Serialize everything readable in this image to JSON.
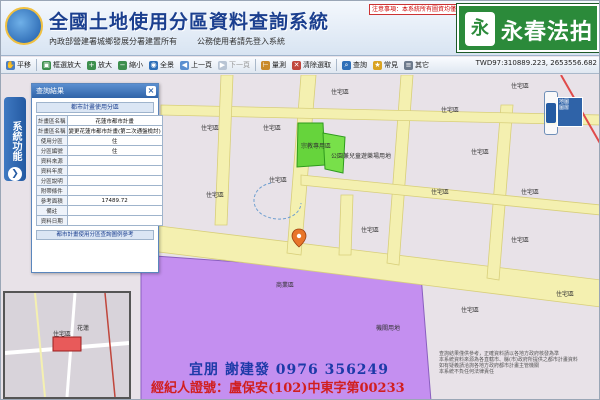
{
  "header": {
    "title": "全國土地使用分區資料查詢系統",
    "sub_left": "內政部營建署城鄉發展分署建置所有",
    "sub_right": "公務使用者請先登入系統",
    "notice": "注意事項：本系統所有圖資均僅供參考",
    "brand_mark": "永",
    "brand_name": "永春法拍"
  },
  "toolbar": {
    "items": [
      {
        "label": "平移",
        "icon": "hand-icon"
      },
      {
        "label": "框選放大",
        "icon": "zoom-box-icon"
      },
      {
        "label": "放大",
        "icon": "zoom-in-icon"
      },
      {
        "label": "縮小",
        "icon": "zoom-out-icon"
      },
      {
        "label": "全景",
        "icon": "globe-icon"
      },
      {
        "label": "上一頁",
        "icon": "back-icon"
      },
      {
        "label": "下一頁",
        "icon": "forward-icon"
      },
      {
        "label": "量測",
        "icon": "ruler-icon"
      },
      {
        "label": "清除選取",
        "icon": "eraser-icon"
      },
      {
        "label": "查詢",
        "icon": "search-icon"
      },
      {
        "label": "常見",
        "icon": "star-icon"
      },
      {
        "label": "其它",
        "icon": "menu-icon"
      }
    ],
    "coords": "TWD97:310889.223, 2653556.682"
  },
  "side_tab": {
    "label": "系統功能",
    "arrow": "❯"
  },
  "result_panel": {
    "title": "查詢結果",
    "close": "×",
    "caption": "都市計畫使用分區",
    "rows": [
      {
        "k": "計畫區名稱",
        "v": "花蓮市都市計畫"
      },
      {
        "k": "計畫區名稱",
        "v": "變更花蓮市都市計畫(第二次通盤檢討)"
      },
      {
        "k": "使用分區",
        "v": "住"
      },
      {
        "k": "分區編號",
        "v": "住"
      },
      {
        "k": "資料來源",
        "v": ""
      },
      {
        "k": "資料年度",
        "v": ""
      },
      {
        "k": "分區說明",
        "v": ""
      },
      {
        "k": "附帶條件",
        "v": ""
      },
      {
        "k": "參考面積",
        "v": "17489.72"
      },
      {
        "k": "備註",
        "v": ""
      },
      {
        "k": "資料日期",
        "v": ""
      }
    ],
    "footer": "都市計畫使用分區查詢圖例參考"
  },
  "map_labels": {
    "l1": "住宅區",
    "l2": "住宅區",
    "l3": "住宅區",
    "l4": "住宅區",
    "l5": "住宅區",
    "l6": "住宅區",
    "l7": "住宅區",
    "l8": "住宅區",
    "l9": "住宅區",
    "l10": "宗教專用區",
    "l11": "公園兼兒童遊樂場用地",
    "l12": "住宅區",
    "l13": "住宅區",
    "l14": "商業區",
    "l15": "住宅區",
    "l16": "機關用地",
    "l17": "住宅區",
    "l18": "住宅區"
  },
  "overview": {
    "label_a": "花蓮",
    "label_b": "住宅區"
  },
  "layer_box": {
    "line1": "地圖",
    "line2": "圖層"
  },
  "agent": {
    "line1": "宜朋  謝建發  0976 356249",
    "line2": "經紀人證號：盧保安(102)中東字第00233"
  },
  "footer_notes": [
    "查詢結果僅供參考，正確資料請以各地方政府核發為準",
    "本系統資料來源為各直轄市、縣(市)政府所提供之都市計畫資料",
    "如有疑義請洽詢各地方政府都市計畫主管機關",
    "本系統不負任何法律責任"
  ],
  "colors": {
    "header_title": "#1b3f8f",
    "brand_green": "#2b8a3a",
    "zone_purple": "#c48ff0",
    "park_green": "#66d43c",
    "agent_blue": "#1d3aa8",
    "agent_red": "#d11f1f",
    "road_yellow": "#f4f0b0"
  }
}
